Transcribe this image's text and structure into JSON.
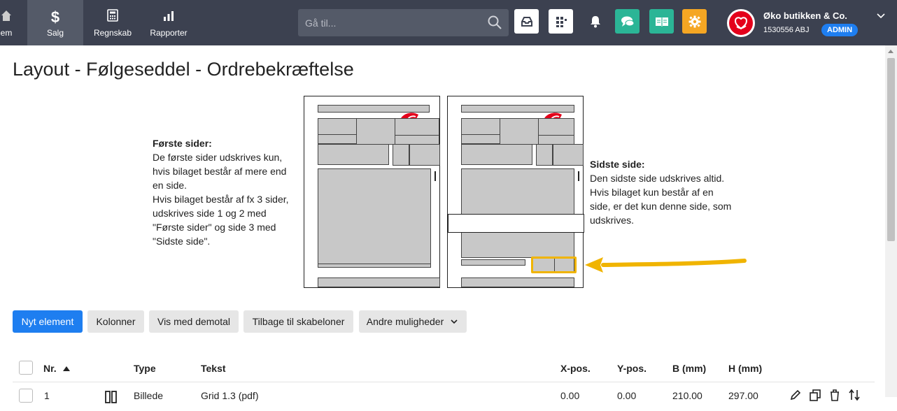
{
  "nav": {
    "partial_label": "em",
    "items": [
      {
        "label": "Salg",
        "icon": "dollar-icon"
      },
      {
        "label": "Regnskab",
        "icon": "calculator-icon"
      },
      {
        "label": "Rapporter",
        "icon": "bar-chart-icon"
      }
    ],
    "search_placeholder": "Gå til...",
    "company_name": "Øko butikken & Co.",
    "company_number": "1530556 ABJ",
    "role_badge": "ADMIN"
  },
  "title": "Layout - Følgeseddel - Ordrebekræftelse",
  "help_first": {
    "heading": "Første sider:",
    "body": "De første sider udskrives kun,\nhvis bilaget består af mere end\nen side.\nHvis bilaget består af fx 3 sider,\nudskrives side 1 og 2 med\n\"Første sider\" og side 3 med\n\"Sidste side\"."
  },
  "help_last": {
    "heading": "Sidste side:",
    "body": "Den sidste side udskrives altid.\nHvis bilaget kun består af en\nside, er det kun denne side, som\nudskrives."
  },
  "buttons": {
    "new_element": "Nyt element",
    "columns": "Kolonner",
    "demo": "Vis med demotal",
    "back": "Tilbage til skabeloner",
    "more": "Andre muligheder"
  },
  "table": {
    "headers": {
      "nr": "Nr.",
      "type": "Type",
      "text": "Tekst",
      "x": "X-pos.",
      "y": "Y-pos.",
      "b": "B (mm)",
      "h": "H (mm)"
    },
    "rows": [
      {
        "nr": "1",
        "type": "Billede",
        "text": "Grid 1.3 (pdf)",
        "x": "0.00",
        "y": "0.00",
        "b": "210.00",
        "h": "297.00"
      }
    ]
  },
  "colors": {
    "nav_bg": "#3c4150",
    "primary": "#1e7ef0",
    "teal": "#2bb596",
    "orange": "#f5a623",
    "highlight": "#f0b400"
  }
}
